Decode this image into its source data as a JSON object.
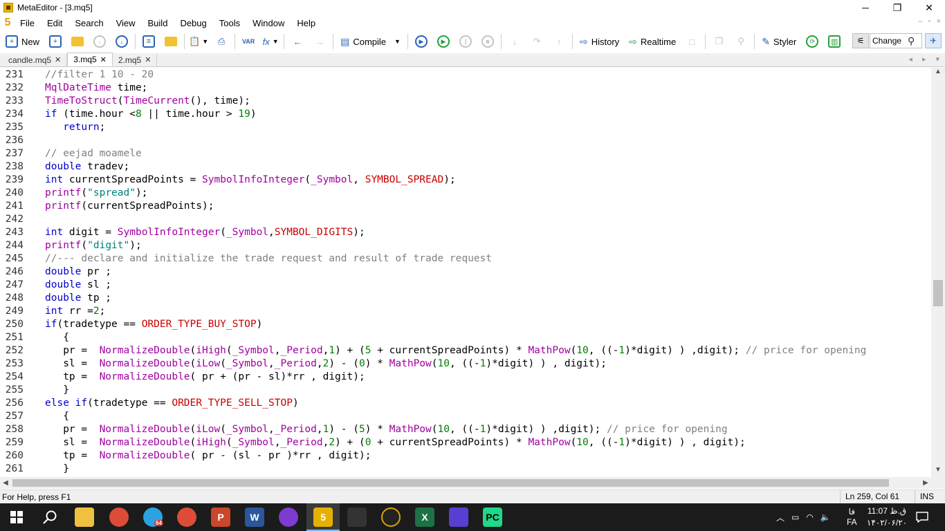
{
  "window": {
    "title": "MetaEditor - [3.mq5]",
    "minimize": "─",
    "maximize": "❐",
    "close": "✕"
  },
  "menu": {
    "logo": "5",
    "items": [
      "File",
      "Edit",
      "Search",
      "View",
      "Build",
      "Debug",
      "Tools",
      "Window",
      "Help"
    ],
    "mdi": [
      "–",
      "▫",
      "×"
    ]
  },
  "toolbar": {
    "new_label": "New",
    "compile_label": "Compile",
    "history_label": "History",
    "realtime_label": "Realtime",
    "styler_label": "Styler",
    "search_value": "Change",
    "var_label": "VAR",
    "fx_label": "fx"
  },
  "tabs": [
    {
      "label": "candle.mq5",
      "active": false
    },
    {
      "label": "3.mq5",
      "active": true
    },
    {
      "label": "2.mq5",
      "active": false
    }
  ],
  "tab_close": "✕",
  "tab_nav": [
    "◂",
    "▸",
    "▾"
  ],
  "code_lines": [
    {
      "no": "231",
      "tokens": [
        [
          "c",
          "//filter 1 10 - 20"
        ]
      ]
    },
    {
      "no": "232",
      "tokens": [
        [
          "f",
          "MqlDateTime"
        ],
        [
          "",
          " time;"
        ]
      ]
    },
    {
      "no": "233",
      "tokens": [
        [
          "f",
          "TimeToStruct"
        ],
        [
          "",
          "("
        ],
        [
          "f",
          "TimeCurrent"
        ],
        [
          "",
          "(), time);"
        ]
      ]
    },
    {
      "no": "234",
      "tokens": [
        [
          "k",
          "if"
        ],
        [
          "",
          " (time.hour <"
        ],
        [
          "n",
          "8"
        ],
        [
          "",
          " || time.hour > "
        ],
        [
          "n",
          "19"
        ],
        [
          "",
          ")"
        ]
      ]
    },
    {
      "no": "235",
      "tokens": [
        [
          "",
          "   "
        ],
        [
          "k",
          "return"
        ],
        [
          "",
          ";"
        ]
      ]
    },
    {
      "no": "236",
      "tokens": []
    },
    {
      "no": "237",
      "tokens": [
        [
          "c",
          "// eejad moamele"
        ]
      ]
    },
    {
      "no": "238",
      "tokens": [
        [
          "k",
          "double"
        ],
        [
          "",
          " tradev;"
        ]
      ]
    },
    {
      "no": "239",
      "tokens": [
        [
          "k",
          "int"
        ],
        [
          "",
          " currentSpreadPoints = "
        ],
        [
          "f",
          "SymbolInfoInteger"
        ],
        [
          "",
          "("
        ],
        [
          "f",
          "_Symbol"
        ],
        [
          "",
          ", "
        ],
        [
          "m",
          "SYMBOL_SPREAD"
        ],
        [
          "",
          ");"
        ]
      ]
    },
    {
      "no": "240",
      "tokens": [
        [
          "f",
          "printf"
        ],
        [
          "",
          "("
        ],
        [
          "s",
          "\"spread\""
        ],
        [
          "",
          ");"
        ]
      ]
    },
    {
      "no": "241",
      "tokens": [
        [
          "f",
          "printf"
        ],
        [
          "",
          "(currentSpreadPoints);"
        ]
      ]
    },
    {
      "no": "242",
      "tokens": []
    },
    {
      "no": "243",
      "tokens": [
        [
          "k",
          "int"
        ],
        [
          "",
          " digit = "
        ],
        [
          "f",
          "SymbolInfoInteger"
        ],
        [
          "",
          "("
        ],
        [
          "f",
          "_Symbol"
        ],
        [
          "",
          ","
        ],
        [
          "m",
          "SYMBOL_DIGITS"
        ],
        [
          "",
          ");"
        ]
      ]
    },
    {
      "no": "244",
      "tokens": [
        [
          "f",
          "printf"
        ],
        [
          "",
          "("
        ],
        [
          "s",
          "\"digit\""
        ],
        [
          "",
          ");"
        ]
      ]
    },
    {
      "no": "245",
      "tokens": [
        [
          "c",
          "//--- declare and initialize the trade request and result of trade request"
        ]
      ]
    },
    {
      "no": "246",
      "tokens": [
        [
          "k",
          "double"
        ],
        [
          "",
          " pr ;"
        ]
      ]
    },
    {
      "no": "247",
      "tokens": [
        [
          "k",
          "double"
        ],
        [
          "",
          " sl ;"
        ]
      ]
    },
    {
      "no": "248",
      "tokens": [
        [
          "k",
          "double"
        ],
        [
          "",
          " tp ;"
        ]
      ]
    },
    {
      "no": "249",
      "tokens": [
        [
          "k",
          "int"
        ],
        [
          "",
          " rr ="
        ],
        [
          "n",
          "2"
        ],
        [
          "",
          ";"
        ]
      ]
    },
    {
      "no": "250",
      "tokens": [
        [
          "k",
          "if"
        ],
        [
          "",
          "(tradetype == "
        ],
        [
          "m",
          "ORDER_TYPE_BUY_STOP"
        ],
        [
          "",
          ")"
        ]
      ]
    },
    {
      "no": "251",
      "tokens": [
        [
          "",
          "   {"
        ]
      ]
    },
    {
      "no": "252",
      "tokens": [
        [
          "",
          "   pr =  "
        ],
        [
          "f",
          "NormalizeDouble"
        ],
        [
          "",
          "("
        ],
        [
          "f",
          "iHigh"
        ],
        [
          "",
          "("
        ],
        [
          "f",
          "_Symbol"
        ],
        [
          "",
          ","
        ],
        [
          "f",
          "_Period"
        ],
        [
          "",
          ","
        ],
        [
          "n",
          "1"
        ],
        [
          "",
          ") + ("
        ],
        [
          "n",
          "5"
        ],
        [
          "",
          " + currentSpreadPoints) * "
        ],
        [
          "f",
          "MathPow"
        ],
        [
          "",
          "("
        ],
        [
          "n",
          "10"
        ],
        [
          "",
          ", ((-"
        ],
        [
          "n",
          "1"
        ],
        [
          "",
          ")*digit) ) ,digit); "
        ],
        [
          "c",
          "// price for opening"
        ]
      ]
    },
    {
      "no": "253",
      "tokens": [
        [
          "",
          "   sl =  "
        ],
        [
          "f",
          "NormalizeDouble"
        ],
        [
          "",
          "("
        ],
        [
          "f",
          "iLow"
        ],
        [
          "",
          "("
        ],
        [
          "f",
          "_Symbol"
        ],
        [
          "",
          ","
        ],
        [
          "f",
          "_Period"
        ],
        [
          "",
          ","
        ],
        [
          "n",
          "2"
        ],
        [
          "",
          ") - ("
        ],
        [
          "n",
          "0"
        ],
        [
          "",
          ") * "
        ],
        [
          "f",
          "MathPow"
        ],
        [
          "",
          "("
        ],
        [
          "n",
          "10"
        ],
        [
          "",
          ", ((-"
        ],
        [
          "n",
          "1"
        ],
        [
          "",
          ")*digit) ) , digit);"
        ]
      ]
    },
    {
      "no": "254",
      "tokens": [
        [
          "",
          "   tp =  "
        ],
        [
          "f",
          "NormalizeDouble"
        ],
        [
          "",
          "( pr + (pr - sl)*rr , digit);"
        ]
      ]
    },
    {
      "no": "255",
      "tokens": [
        [
          "",
          "   }"
        ]
      ]
    },
    {
      "no": "256",
      "tokens": [
        [
          "k",
          "else"
        ],
        [
          "",
          " "
        ],
        [
          "k",
          "if"
        ],
        [
          "",
          "(tradetype == "
        ],
        [
          "m",
          "ORDER_TYPE_SELL_STOP"
        ],
        [
          "",
          ")"
        ]
      ]
    },
    {
      "no": "257",
      "tokens": [
        [
          "",
          "   {"
        ]
      ]
    },
    {
      "no": "258",
      "tokens": [
        [
          "",
          "   pr =  "
        ],
        [
          "f",
          "NormalizeDouble"
        ],
        [
          "",
          "("
        ],
        [
          "f",
          "iLow"
        ],
        [
          "",
          "("
        ],
        [
          "f",
          "_Symbol"
        ],
        [
          "",
          ","
        ],
        [
          "f",
          "_Period"
        ],
        [
          "",
          ","
        ],
        [
          "n",
          "1"
        ],
        [
          "",
          ") - ("
        ],
        [
          "n",
          "5"
        ],
        [
          "",
          ") * "
        ],
        [
          "f",
          "MathPow"
        ],
        [
          "",
          "("
        ],
        [
          "n",
          "10"
        ],
        [
          "",
          ", ((-"
        ],
        [
          "n",
          "1"
        ],
        [
          "",
          ")*digit) ) ,digit); "
        ],
        [
          "c",
          "// price for opening"
        ]
      ]
    },
    {
      "no": "259",
      "tokens": [
        [
          "",
          "   sl =  "
        ],
        [
          "f",
          "NormalizeDouble"
        ],
        [
          "",
          "("
        ],
        [
          "f",
          "iHigh"
        ],
        [
          "",
          "("
        ],
        [
          "f",
          "_Symbol"
        ],
        [
          "",
          ","
        ],
        [
          "f",
          "_Period"
        ],
        [
          "",
          ","
        ],
        [
          "n",
          "2"
        ],
        [
          "",
          ") + ("
        ],
        [
          "n",
          "0"
        ],
        [
          "",
          " + currentSpreadPoints) * "
        ],
        [
          "f",
          "MathPow"
        ],
        [
          "",
          "("
        ],
        [
          "n",
          "10"
        ],
        [
          "",
          ", ((-"
        ],
        [
          "n",
          "1"
        ],
        [
          "",
          ")*digit) ) , digit);"
        ]
      ]
    },
    {
      "no": "260",
      "tokens": [
        [
          "",
          "   tp =  "
        ],
        [
          "f",
          "NormalizeDouble"
        ],
        [
          "",
          "( pr - (sl - pr )*rr , digit);"
        ]
      ]
    },
    {
      "no": "261",
      "tokens": [
        [
          "",
          "   }"
        ]
      ]
    }
  ],
  "scroll": {
    "up": "▲",
    "down": "▼",
    "left": "◀",
    "right": "▶"
  },
  "status": {
    "help": "For Help, press F1",
    "position": "Ln 259, Col 61",
    "mode": "INS"
  },
  "taskbar": {
    "start_icon": "windows-icon",
    "lang": "FA",
    "lang_top": "فا",
    "time": "11:07 ق.ظ",
    "date": "۱۴۰۲/۰۶/۲۰",
    "apps": [
      "file-explorer",
      "chrome",
      "telegram",
      "chrome",
      "powerpoint",
      "word",
      "tor",
      "metaeditor",
      "app",
      "app",
      "excel",
      "vpn",
      "pycharm"
    ],
    "telegram_badge": "64"
  },
  "colors": {
    "keyword": "#0000c8",
    "function": "#a000a0",
    "comment": "#808080",
    "string": "#008080",
    "number": "#008000",
    "macro": "#c80000"
  }
}
